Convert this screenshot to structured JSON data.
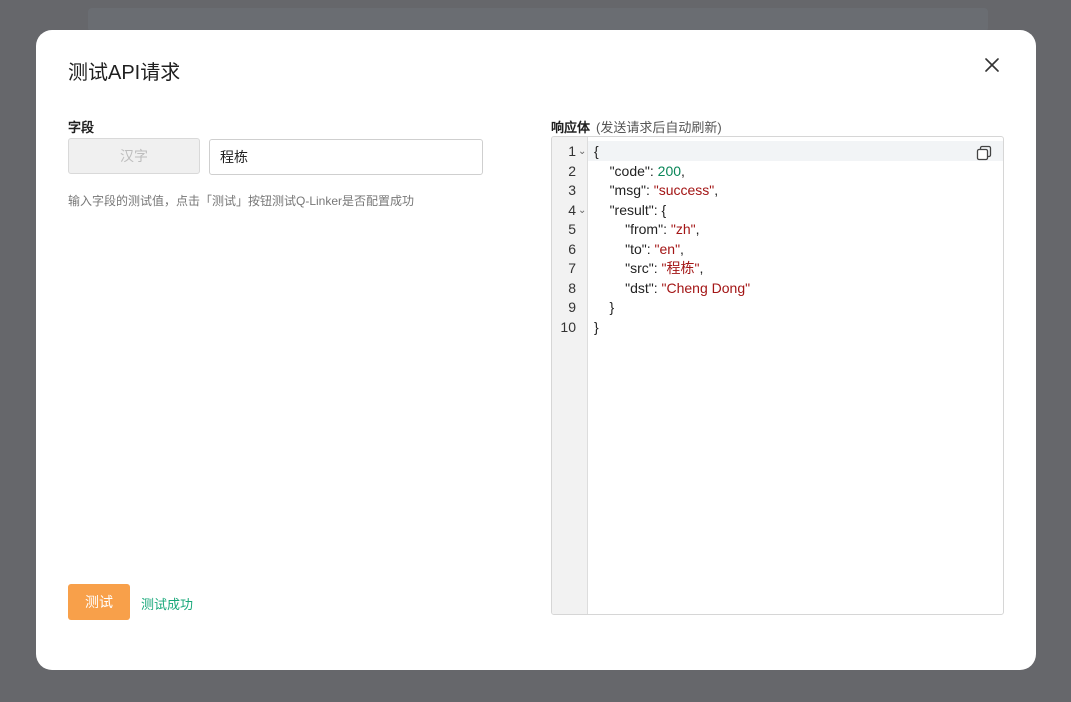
{
  "dialog": {
    "title": "测试API请求",
    "close_icon": "close-icon"
  },
  "left": {
    "label": "字段",
    "field_key": "汉字",
    "field_value": "程栋",
    "hint": "输入字段的测试值，点击「测试」按钮测试Q-Linker是否配置成功",
    "test_button": "测试",
    "test_result": "测试成功"
  },
  "right": {
    "label": "响应体",
    "label_sub": "(发送请求后自动刷新)",
    "copy_icon": "copy-icon",
    "line_numbers": [
      "1",
      "2",
      "3",
      "4",
      "5",
      "6",
      "7",
      "8",
      "9",
      "10"
    ],
    "lines": [
      {
        "indent": "",
        "key": "",
        "value": "",
        "text": "{"
      },
      {
        "indent": "    ",
        "key": "\"code\"",
        "value": "200",
        "type": "n",
        "suffix": ","
      },
      {
        "indent": "    ",
        "key": "\"msg\"",
        "value": "\"success\"",
        "type": "s",
        "suffix": ","
      },
      {
        "indent": "    ",
        "key": "\"result\"",
        "value": "{",
        "type": "k",
        "suffix": ""
      },
      {
        "indent": "        ",
        "key": "\"from\"",
        "value": "\"zh\"",
        "type": "s",
        "suffix": ","
      },
      {
        "indent": "        ",
        "key": "\"to\"",
        "value": "\"en\"",
        "type": "s",
        "suffix": ","
      },
      {
        "indent": "        ",
        "key": "\"src\"",
        "value": "\"程栋\"",
        "type": "s",
        "suffix": ","
      },
      {
        "indent": "        ",
        "key": "\"dst\"",
        "value": "\"Cheng Dong\"",
        "type": "s",
        "suffix": ""
      },
      {
        "indent": "    ",
        "key": "",
        "value": "",
        "text": "}"
      },
      {
        "indent": "",
        "key": "",
        "value": "",
        "text": "}"
      }
    ],
    "fold_lines": [
      1,
      4
    ]
  },
  "colors": {
    "accent": "#f8a04a",
    "success": "#18a87a",
    "string": "#a31515",
    "number": "#098658"
  }
}
